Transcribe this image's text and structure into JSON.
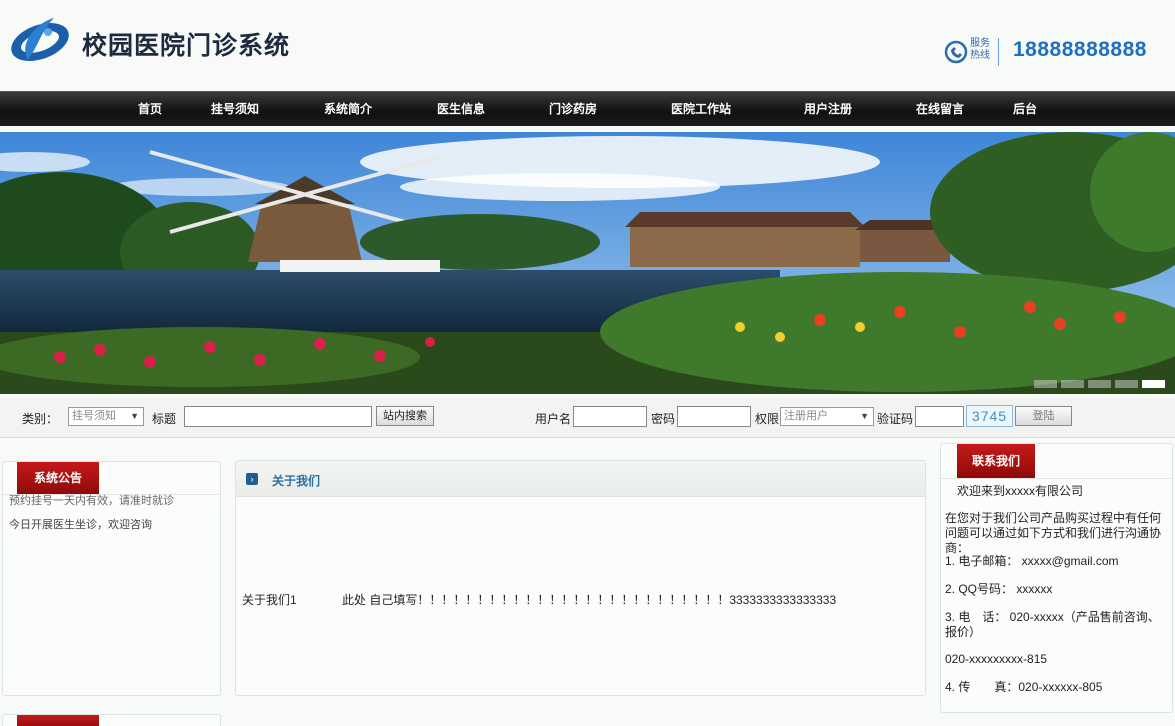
{
  "header": {
    "site_title": "校园医院门诊系统",
    "hotline_label": "服务热线",
    "hotline_number": "18888888888"
  },
  "nav": {
    "items": [
      {
        "label": "首页"
      },
      {
        "label": "挂号须知"
      },
      {
        "label": "系统简介"
      },
      {
        "label": "医生信息"
      },
      {
        "label": "门诊药房"
      },
      {
        "label": "医院工作站"
      },
      {
        "label": "用户注册"
      },
      {
        "label": "在线留言"
      },
      {
        "label": "后台"
      }
    ]
  },
  "banner": {
    "slide_count": 5,
    "active_slide": 5
  },
  "search": {
    "category_label": "类别：",
    "category_value": "挂号须知",
    "title_label": "标题",
    "title_value": "",
    "search_button": "站内搜索"
  },
  "login": {
    "username_label": "用户名",
    "password_label": "密码",
    "role_label": "权限",
    "role_value": "注册用户",
    "captcha_label": "验证码",
    "captcha_code": "3745",
    "login_button": "登陆"
  },
  "notice": {
    "tab_label": "系统公告",
    "lines": [
      "预约挂号一天内有效，请准时就诊",
      "今日开展医生坐诊，欢迎咨询"
    ]
  },
  "about": {
    "title": "关于我们",
    "row_name": "关于我们1",
    "row_text": "此处 自己填写！！！！！！！！！！！！！！！！！！！！！！！！！！3333333333333333"
  },
  "contact": {
    "tab_label": "联系我们",
    "welcome": "欢迎来到xxxxx有限公司",
    "intro": "在您对于我们公司产品购买过程中有任何问题可以通过如下方式和我们进行沟通协商：",
    "email": "1. 电子邮箱： xxxxx@gmail.com",
    "qq": "2. QQ号码： xxxxxx",
    "phone": "3. 电　话： 020-xxxxx（产品售前咨询、报价）",
    "phone2": "020-xxxxxxxxx-815",
    "fax": "4. 传　　真：020-xxxxxx-805"
  },
  "colors": {
    "nav_bg": "#141414",
    "accent_red": "#b01010",
    "link_blue": "#2b6fa5",
    "hotline_blue": "#1f6fc1"
  }
}
